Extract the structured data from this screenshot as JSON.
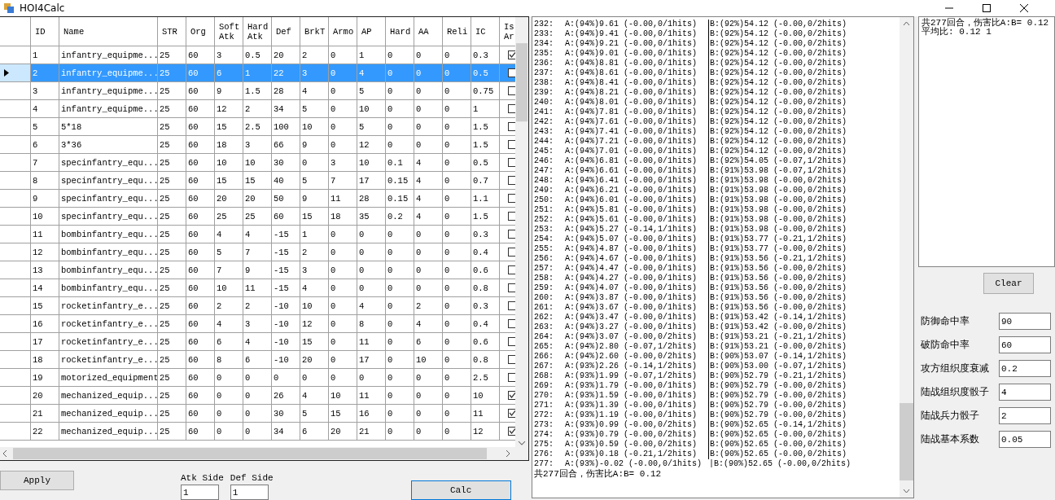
{
  "window": {
    "title": "HOI4Calc"
  },
  "table": {
    "columns": [
      "ID",
      "Name",
      "STR",
      "Org",
      "Soft Atk",
      "Hard Atk",
      "Def",
      "BrkT",
      "Armo",
      "AP",
      "Hard",
      "AA",
      "Reli",
      "IC",
      "Is Ar"
    ],
    "rows": [
      {
        "selected": false,
        "checked": true,
        "cells": [
          "1",
          "infantry_equipme...",
          "25",
          "60",
          "3",
          "0.5",
          "20",
          "2",
          "0",
          "1",
          "0",
          "0",
          "0",
          "0.3"
        ]
      },
      {
        "selected": true,
        "checked": false,
        "cells": [
          "2",
          "infantry_equipme...",
          "25",
          "60",
          "6",
          "1",
          "22",
          "3",
          "0",
          "4",
          "0",
          "0",
          "0",
          "0.5"
        ]
      },
      {
        "selected": false,
        "checked": false,
        "cells": [
          "3",
          "infantry_equipme...",
          "25",
          "60",
          "9",
          "1.5",
          "28",
          "4",
          "0",
          "5",
          "0",
          "0",
          "0",
          "0.75"
        ]
      },
      {
        "selected": false,
        "checked": false,
        "cells": [
          "4",
          "infantry_equipme...",
          "25",
          "60",
          "12",
          "2",
          "34",
          "5",
          "0",
          "10",
          "0",
          "0",
          "0",
          "1"
        ]
      },
      {
        "selected": false,
        "checked": false,
        "cells": [
          "5",
          "5*18",
          "25",
          "60",
          "15",
          "2.5",
          "100",
          "10",
          "0",
          "5",
          "0",
          "0",
          "0",
          "1.5"
        ]
      },
      {
        "selected": false,
        "checked": false,
        "cells": [
          "6",
          "3*36",
          "25",
          "60",
          "18",
          "3",
          "66",
          "9",
          "0",
          "12",
          "0",
          "0",
          "0",
          "1.5"
        ]
      },
      {
        "selected": false,
        "checked": false,
        "cells": [
          "7",
          "specinfantry_equ...",
          "25",
          "60",
          "10",
          "10",
          "30",
          "0",
          "3",
          "10",
          "0.1",
          "4",
          "0",
          "0.5"
        ]
      },
      {
        "selected": false,
        "checked": false,
        "cells": [
          "8",
          "specinfantry_equ...",
          "25",
          "60",
          "15",
          "15",
          "40",
          "5",
          "7",
          "17",
          "0.15",
          "4",
          "0",
          "0.7"
        ]
      },
      {
        "selected": false,
        "checked": false,
        "cells": [
          "9",
          "specinfantry_equ...",
          "25",
          "60",
          "20",
          "20",
          "50",
          "9",
          "11",
          "28",
          "0.15",
          "4",
          "0",
          "1.1"
        ]
      },
      {
        "selected": false,
        "checked": false,
        "cells": [
          "10",
          "specinfantry_equ...",
          "25",
          "60",
          "25",
          "25",
          "60",
          "15",
          "18",
          "35",
          "0.2",
          "4",
          "0",
          "1.5"
        ]
      },
      {
        "selected": false,
        "checked": false,
        "cells": [
          "11",
          "bombinfantry_equ...",
          "25",
          "60",
          "4",
          "4",
          "-15",
          "1",
          "0",
          "0",
          "0",
          "0",
          "0",
          "0.3"
        ]
      },
      {
        "selected": false,
        "checked": false,
        "cells": [
          "12",
          "bombinfantry_equ...",
          "25",
          "60",
          "5",
          "7",
          "-15",
          "2",
          "0",
          "0",
          "0",
          "0",
          "0",
          "0.4"
        ]
      },
      {
        "selected": false,
        "checked": false,
        "cells": [
          "13",
          "bombinfantry_equ...",
          "25",
          "60",
          "7",
          "9",
          "-15",
          "3",
          "0",
          "0",
          "0",
          "0",
          "0",
          "0.6"
        ]
      },
      {
        "selected": false,
        "checked": false,
        "cells": [
          "14",
          "bombinfantry_equ...",
          "25",
          "60",
          "10",
          "11",
          "-15",
          "4",
          "0",
          "0",
          "0",
          "0",
          "0",
          "0.8"
        ]
      },
      {
        "selected": false,
        "checked": false,
        "cells": [
          "15",
          "rocketinfantry_e...",
          "25",
          "60",
          "2",
          "2",
          "-10",
          "10",
          "0",
          "4",
          "0",
          "2",
          "0",
          "0.3"
        ]
      },
      {
        "selected": false,
        "checked": false,
        "cells": [
          "16",
          "rocketinfantry_e...",
          "25",
          "60",
          "4",
          "3",
          "-10",
          "12",
          "0",
          "8",
          "0",
          "4",
          "0",
          "0.4"
        ]
      },
      {
        "selected": false,
        "checked": false,
        "cells": [
          "17",
          "rocketinfantry_e...",
          "25",
          "60",
          "6",
          "4",
          "-10",
          "15",
          "0",
          "11",
          "0",
          "6",
          "0",
          "0.6"
        ]
      },
      {
        "selected": false,
        "checked": false,
        "cells": [
          "18",
          "rocketinfantry_e...",
          "25",
          "60",
          "8",
          "6",
          "-10",
          "20",
          "0",
          "17",
          "0",
          "10",
          "0",
          "0.8"
        ]
      },
      {
        "selected": false,
        "checked": false,
        "cells": [
          "19",
          "motorized_equipment",
          "25",
          "60",
          "0",
          "0",
          "0",
          "0",
          "0",
          "0",
          "0",
          "0",
          "0",
          "2.5"
        ]
      },
      {
        "selected": false,
        "checked": true,
        "cells": [
          "20",
          "mechanized_equip...",
          "25",
          "60",
          "0",
          "0",
          "26",
          "4",
          "10",
          "11",
          "0",
          "0",
          "0",
          "10"
        ]
      },
      {
        "selected": false,
        "checked": true,
        "cells": [
          "21",
          "mechanized_equip...",
          "25",
          "60",
          "0",
          "0",
          "30",
          "5",
          "15",
          "16",
          "0",
          "0",
          "0",
          "11"
        ]
      },
      {
        "selected": false,
        "checked": true,
        "cells": [
          "22",
          "mechanized_equip...",
          "25",
          "60",
          "0",
          "0",
          "34",
          "6",
          "20",
          "21",
          "0",
          "0",
          "0",
          "12"
        ]
      }
    ]
  },
  "apply_button": "Apply",
  "atk_side": {
    "label": "Atk Side",
    "value": "1"
  },
  "def_side": {
    "label": "Def Side",
    "value": "1"
  },
  "calc_button": "Calc",
  "log": {
    "lines": [
      {
        "round": "232:",
        "a": "A:(94%)9.61 (-0.00,0/1hits)",
        "b": "B:(92%)54.12 (-0.00,0/2hits)",
        "divider": true
      },
      {
        "round": "233:",
        "a": "A:(94%)9.41 (-0.00,0/1hits)",
        "b": "B:(92%)54.12 (-0.00,0/2hits)",
        "divider": true
      },
      {
        "round": "234:",
        "a": "A:(94%)9.21 (-0.00,0/1hits)",
        "b": "B:(92%)54.12 (-0.00,0/2hits)",
        "divider": true
      },
      {
        "round": "235:",
        "a": "A:(94%)9.01 (-0.00,0/1hits)",
        "b": "B:(92%)54.12 (-0.00,0/2hits)",
        "divider": true
      },
      {
        "round": "236:",
        "a": "A:(94%)8.81 (-0.00,0/1hits)",
        "b": "B:(92%)54.12 (-0.00,0/2hits)",
        "divider": true
      },
      {
        "round": "237:",
        "a": "A:(94%)8.61 (-0.00,0/1hits)",
        "b": "B:(92%)54.12 (-0.00,0/2hits)",
        "divider": true
      },
      {
        "round": "238:",
        "a": "A:(94%)8.41 (-0.00,0/1hits)",
        "b": "B:(92%)54.12 (-0.00,0/2hits)",
        "divider": true
      },
      {
        "round": "239:",
        "a": "A:(94%)8.21 (-0.00,0/1hits)",
        "b": "B:(92%)54.12 (-0.00,0/2hits)",
        "divider": true
      },
      {
        "round": "240:",
        "a": "A:(94%)8.01 (-0.00,0/1hits)",
        "b": "B:(92%)54.12 (-0.00,0/2hits)",
        "divider": true
      },
      {
        "round": "241:",
        "a": "A:(94%)7.81 (-0.00,0/1hits)",
        "b": "B:(92%)54.12 (-0.00,0/2hits)",
        "divider": true
      },
      {
        "round": "242:",
        "a": "A:(94%)7.61 (-0.00,0/1hits)",
        "b": "B:(92%)54.12 (-0.00,0/2hits)",
        "divider": true
      },
      {
        "round": "243:",
        "a": "A:(94%)7.41 (-0.00,0/1hits)",
        "b": "B:(92%)54.12 (-0.00,0/2hits)",
        "divider": true
      },
      {
        "round": "244:",
        "a": "A:(94%)7.21 (-0.00,0/1hits)",
        "b": "B:(92%)54.12 (-0.00,0/2hits)",
        "divider": true
      },
      {
        "round": "245:",
        "a": "A:(94%)7.01 (-0.00,0/1hits)",
        "b": "B:(92%)54.12 (-0.00,0/2hits)",
        "divider": true
      },
      {
        "round": "246:",
        "a": "A:(94%)6.81 (-0.00,0/1hits)",
        "b": "B:(92%)54.05 (-0.07,1/2hits)",
        "divider": true
      },
      {
        "round": "247:",
        "a": "A:(94%)6.61 (-0.00,0/1hits)",
        "b": "B:(91%)53.98 (-0.07,1/2hits)",
        "divider": true
      },
      {
        "round": "248:",
        "a": "A:(94%)6.41 (-0.00,0/1hits)",
        "b": "B:(91%)53.98 (-0.00,0/2hits)",
        "divider": true
      },
      {
        "round": "249:",
        "a": "A:(94%)6.21 (-0.00,0/1hits)",
        "b": "B:(91%)53.98 (-0.00,0/2hits)",
        "divider": true
      },
      {
        "round": "250:",
        "a": "A:(94%)6.01 (-0.00,0/1hits)",
        "b": "B:(91%)53.98 (-0.00,0/2hits)",
        "divider": true
      },
      {
        "round": "251:",
        "a": "A:(94%)5.81 (-0.00,0/1hits)",
        "b": "B:(91%)53.98 (-0.00,0/2hits)",
        "divider": true
      },
      {
        "round": "252:",
        "a": "A:(94%)5.61 (-0.00,0/1hits)",
        "b": "B:(91%)53.98 (-0.00,0/2hits)",
        "divider": true
      },
      {
        "round": "253:",
        "a": "A:(94%)5.27 (-0.14,1/1hits)",
        "b": "B:(91%)53.98 (-0.00,0/2hits)",
        "divider": true
      },
      {
        "round": "254:",
        "a": "A:(94%)5.07 (-0.00,0/1hits)",
        "b": "B:(91%)53.77 (-0.21,1/2hits)",
        "divider": true
      },
      {
        "round": "255:",
        "a": "A:(94%)4.87 (-0.00,0/1hits)",
        "b": "B:(91%)53.77 (-0.00,0/2hits)",
        "divider": true
      },
      {
        "round": "256:",
        "a": "A:(94%)4.67 (-0.00,0/1hits)",
        "b": "B:(91%)53.56 (-0.21,1/2hits)",
        "divider": true
      },
      {
        "round": "257:",
        "a": "A:(94%)4.47 (-0.00,0/1hits)",
        "b": "B:(91%)53.56 (-0.00,0/2hits)",
        "divider": true
      },
      {
        "round": "258:",
        "a": "A:(94%)4.27 (-0.00,0/1hits)",
        "b": "B:(91%)53.56 (-0.00,0/2hits)",
        "divider": true
      },
      {
        "round": "259:",
        "a": "A:(94%)4.07 (-0.00,0/1hits)",
        "b": "B:(91%)53.56 (-0.00,0/2hits)",
        "divider": true
      },
      {
        "round": "260:",
        "a": "A:(94%)3.87 (-0.00,0/1hits)",
        "b": "B:(91%)53.56 (-0.00,0/2hits)",
        "divider": true
      },
      {
        "round": "261:",
        "a": "A:(94%)3.67 (-0.00,0/1hits)",
        "b": "B:(91%)53.56 (-0.00,0/2hits)",
        "divider": true
      },
      {
        "round": "262:",
        "a": "A:(94%)3.47 (-0.00,0/1hits)",
        "b": "B:(91%)53.42 (-0.14,1/2hits)",
        "divider": true
      },
      {
        "round": "263:",
        "a": "A:(94%)3.27 (-0.00,0/1hits)",
        "b": "B:(91%)53.42 (-0.00,0/2hits)",
        "divider": true
      },
      {
        "round": "264:",
        "a": "A:(94%)3.07 (-0.00,0/2hits)",
        "b": "B:(91%)53.21 (-0.21,1/2hits)",
        "divider": true
      },
      {
        "round": "265:",
        "a": "A:(94%)2.80 (-0.07,1/2hits)",
        "b": "B:(91%)53.21 (-0.00,0/2hits)",
        "divider": true
      },
      {
        "round": "266:",
        "a": "A:(94%)2.60 (-0.00,0/2hits)",
        "b": "B:(90%)53.07 (-0.14,1/2hits)",
        "divider": true
      },
      {
        "round": "267:",
        "a": "A:(93%)2.26 (-0.14,1/2hits)",
        "b": "B:(90%)53.00 (-0.07,1/2hits)",
        "divider": true
      },
      {
        "round": "268:",
        "a": "A:(93%)1.99 (-0.07,1/2hits)",
        "b": "B:(90%)52.79 (-0.21,1/2hits)",
        "divider": true
      },
      {
        "round": "269:",
        "a": "A:(93%)1.79 (-0.00,0/1hits)",
        "b": "B:(90%)52.79 (-0.00,0/2hits)",
        "divider": true
      },
      {
        "round": "270:",
        "a": "A:(93%)1.59 (-0.00,0/1hits)",
        "b": "B:(90%)52.79 (-0.00,0/2hits)",
        "divider": true
      },
      {
        "round": "271:",
        "a": "A:(93%)1.39 (-0.00,0/1hits)",
        "b": "B:(90%)52.79 (-0.00,0/2hits)",
        "divider": true
      },
      {
        "round": "272:",
        "a": "A:(93%)1.19 (-0.00,0/1hits)",
        "b": "B:(90%)52.79 (-0.00,0/2hits)",
        "divider": true
      },
      {
        "round": "273:",
        "a": "A:(93%)0.99 (-0.00,0/2hits)",
        "b": "B:(90%)52.65 (-0.14,1/2hits)",
        "divider": true
      },
      {
        "round": "274:",
        "a": "A:(93%)0.79 (-0.00,0/2hits)",
        "b": "B:(90%)52.65 (-0.00,0/2hits)",
        "divider": true
      },
      {
        "round": "275:",
        "a": "A:(93%)0.59 (-0.00,0/2hits)",
        "b": "B:(90%)52.65 (-0.00,0/2hits)",
        "divider": true
      },
      {
        "round": "276:",
        "a": "A:(93%)0.18 (-0.21,1/2hits)",
        "b": "B:(90%)52.65 (-0.00,0/2hits)",
        "divider": true
      },
      {
        "round": "277:",
        "a": "A:(93%)-0.02 (-0.00,0/1hits)",
        "b": "|B:(90%)52.65 (-0.00,0/2hits)",
        "divider": false
      }
    ],
    "summary": "共277回合，伤害比A:B= 0.12"
  },
  "result": [
    "共277回合，伤害比A:B= 0.12",
    "平均比: 0.12 1"
  ],
  "clear_button": "Clear",
  "settings": [
    {
      "label": "防御命中率",
      "value": "90"
    },
    {
      "label": "破防命中率",
      "value": "60"
    },
    {
      "label": "攻方组织度衰减",
      "value": "0.2"
    },
    {
      "label": "陆战组织度骰子",
      "value": "4"
    },
    {
      "label": "陆战兵力骰子",
      "value": "2"
    },
    {
      "label": "陆战基本系数",
      "value": "0.05"
    }
  ]
}
